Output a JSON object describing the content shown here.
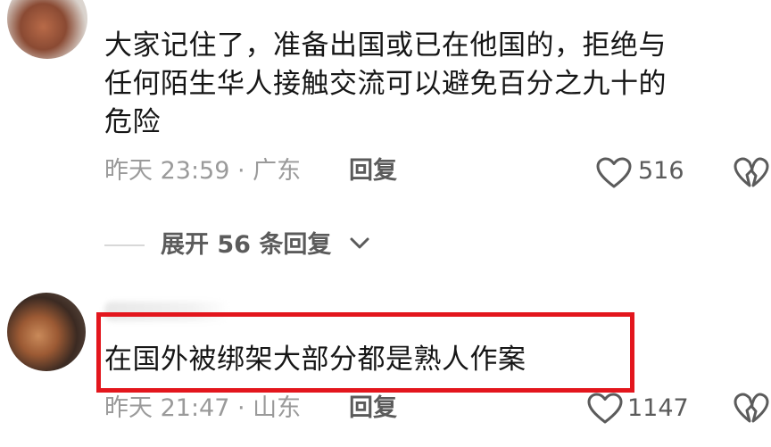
{
  "comments": [
    {
      "text_line1": "大家记住了，准备出国或已在他国的，拒绝与",
      "text_line2": "任何陌生华人接触交流可以避免百分之九十的",
      "text_line3": "危险",
      "time_location": "昨天 23:59 · 广东",
      "reply_label": "回复",
      "likes": "516",
      "like_icon": "heart-outline-icon",
      "dislike_icon": "broken-heart-icon"
    },
    {
      "text": "在国外被绑架大部分都是熟人作案",
      "time_location": "昨天 21:47 · 山东",
      "reply_label": "回复",
      "likes": "1147",
      "like_icon": "heart-outline-icon",
      "dislike_icon": "broken-heart-icon",
      "highlight_color": "#e3161d"
    }
  ],
  "expand_replies": {
    "label": "展开 56 条回复",
    "icon": "chevron-down-icon"
  }
}
